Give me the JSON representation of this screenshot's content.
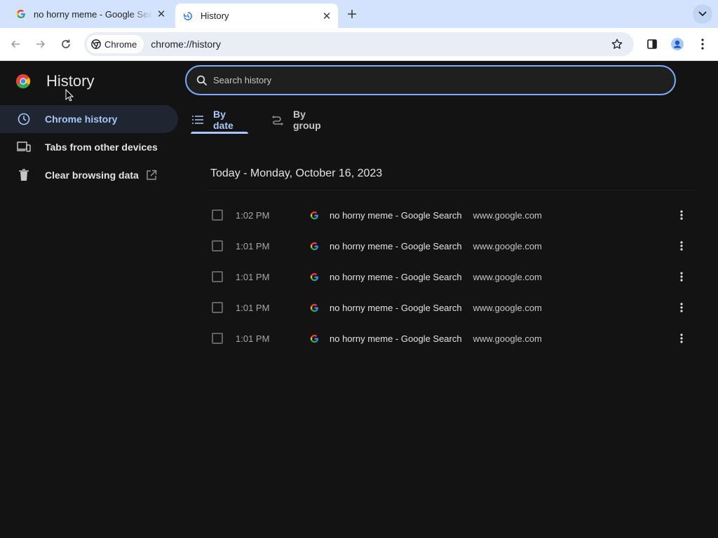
{
  "browser": {
    "tabs": [
      {
        "title": "no horny meme - Google Search"
      },
      {
        "title": "History"
      }
    ],
    "omnibox": {
      "chip_label": "Chrome",
      "url": "chrome://history"
    }
  },
  "history_page": {
    "title": "History",
    "search_placeholder": "Search history",
    "nav": [
      {
        "label": "Chrome history"
      },
      {
        "label": "Tabs from other devices"
      },
      {
        "label": "Clear browsing data"
      }
    ],
    "view_tabs": [
      {
        "label": "By date"
      },
      {
        "label": "By group"
      }
    ],
    "day_header": "Today - Monday, October 16, 2023",
    "entries": [
      {
        "time": "1:02 PM",
        "title": "no horny meme - Google Search",
        "domain": "www.google.com"
      },
      {
        "time": "1:01 PM",
        "title": "no horny meme - Google Search",
        "domain": "www.google.com"
      },
      {
        "time": "1:01 PM",
        "title": "no horny meme - Google Search",
        "domain": "www.google.com"
      },
      {
        "time": "1:01 PM",
        "title": "no horny meme - Google Search",
        "domain": "www.google.com"
      },
      {
        "time": "1:01 PM",
        "title": "no horny meme - Google Search",
        "domain": "www.google.com"
      }
    ]
  },
  "colors": {
    "accent": "#a8c7fa",
    "page_bg": "#131313",
    "tabstrip_bg": "#d3e3fd",
    "selected_nav_bg": "#1f2631"
  }
}
